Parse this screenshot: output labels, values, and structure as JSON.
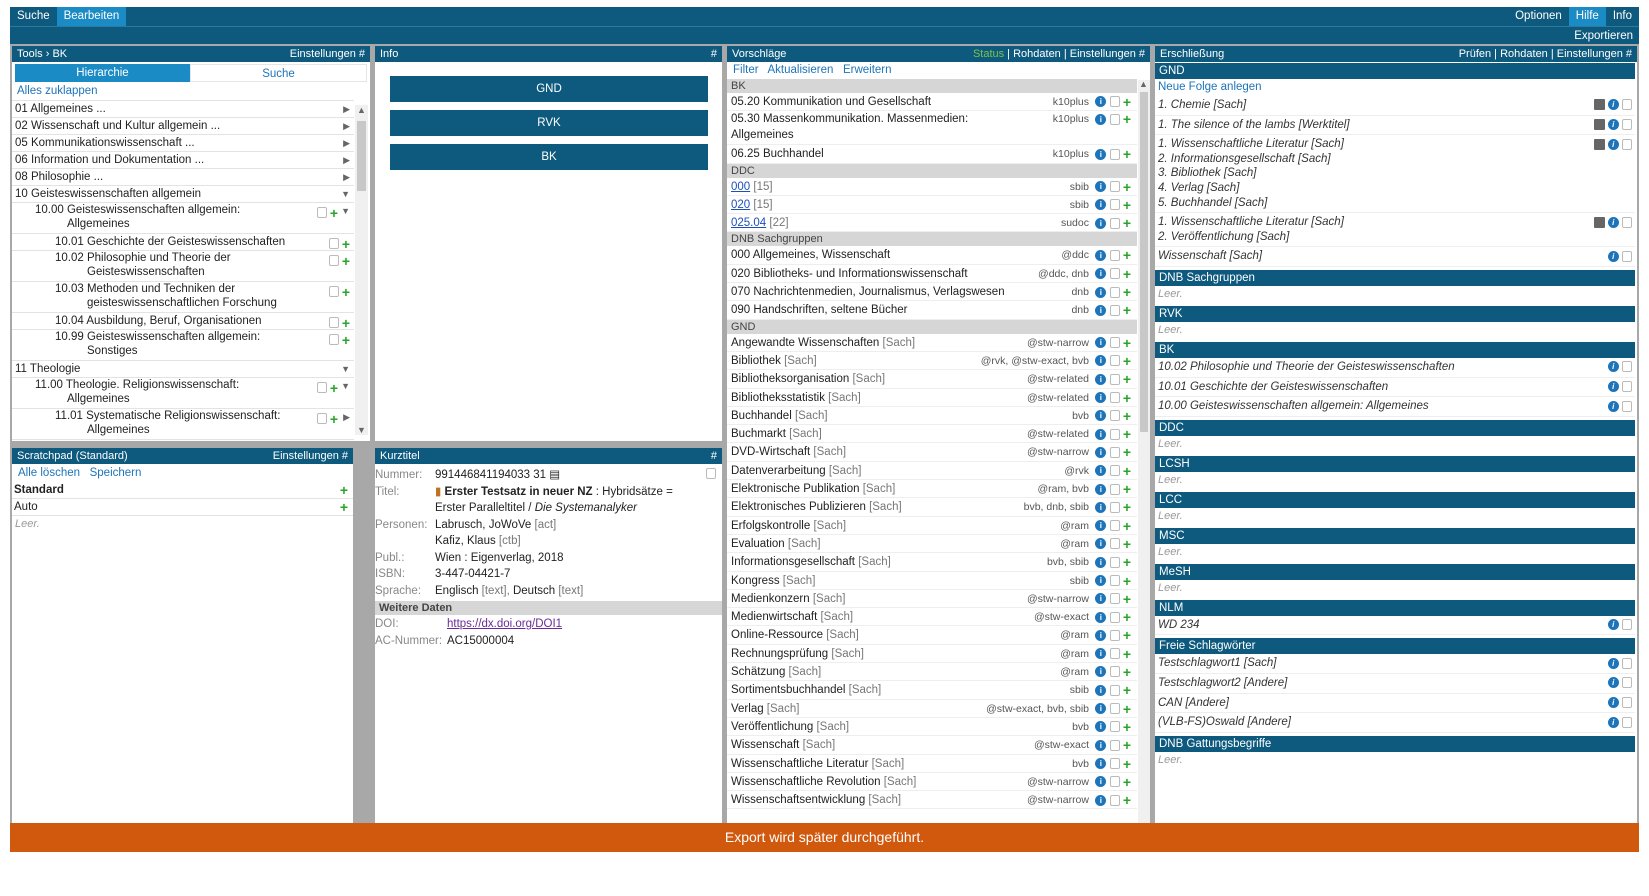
{
  "topbar": {
    "left": [
      "Suche",
      "Bearbeiten"
    ],
    "right": [
      "Optionen",
      "Hilfe",
      "Info"
    ],
    "export": "Exportieren"
  },
  "tools": {
    "title": "Tools › BK",
    "settings": "Einstellungen #",
    "tabs": [
      "Hierarchie",
      "Suche"
    ],
    "collapse_all": "Alles zuklappen",
    "items": [
      {
        "text": "01 Allgemeines ...",
        "indent": 0,
        "arrow": "▶",
        "actions": false
      },
      {
        "text": "02 Wissenschaft und Kultur allgemein ...",
        "indent": 0,
        "arrow": "▶",
        "actions": false
      },
      {
        "text": "05 Kommunikationswissenschaft ...",
        "indent": 0,
        "arrow": "▶",
        "actions": false
      },
      {
        "text": "06 Information und Dokumentation ...",
        "indent": 0,
        "arrow": "▶",
        "actions": false
      },
      {
        "text": "08 Philosophie ...",
        "indent": 0,
        "arrow": "▶",
        "actions": false
      },
      {
        "text": "10 Geisteswissenschaften allgemein",
        "indent": 0,
        "arrow": "▼",
        "actions": false
      },
      {
        "text": "10.00 Geisteswissenschaften allgemein:",
        "text2": "Allgemeines",
        "indent": 1,
        "arrow": "▼",
        "actions": true
      },
      {
        "text": "10.01 Geschichte der Geisteswissenschaften",
        "indent": 2,
        "arrow": "",
        "actions": true
      },
      {
        "text": "10.02 Philosophie und Theorie der",
        "text2": "Geisteswissenschaften",
        "indent": 2,
        "arrow": "",
        "actions": true
      },
      {
        "text": "10.03 Methoden und Techniken der",
        "text2": "geisteswissenschaftlichen Forschung",
        "indent": 2,
        "arrow": "",
        "actions": true
      },
      {
        "text": "10.04 Ausbildung, Beruf, Organisationen",
        "indent": 2,
        "arrow": "",
        "actions": true
      },
      {
        "text": "10.99 Geisteswissenschaften allgemein:",
        "text2": "Sonstiges",
        "indent": 2,
        "arrow": "",
        "actions": true
      },
      {
        "text": "11 Theologie",
        "indent": 0,
        "arrow": "▼",
        "actions": false
      },
      {
        "text": "11.00 Theologie. Religionswissenschaft:",
        "text2": "Allgemeines",
        "indent": 1,
        "arrow": "▼",
        "actions": true
      },
      {
        "text": "11.01 Systematische Religionswissenschaft:",
        "text2": "Allgemeines",
        "indent": 2,
        "arrow": "▶",
        "actions": true
      }
    ]
  },
  "info": {
    "title": "Info",
    "hash": "#",
    "buttons": [
      "GND",
      "RVK",
      "BK"
    ]
  },
  "scratch": {
    "title": "Scratchpad (Standard)",
    "settings": "Einstellungen #",
    "links": [
      "Alle löschen",
      "Speichern"
    ],
    "items": [
      "Standard",
      "Auto"
    ],
    "empty": "Leer."
  },
  "kurz": {
    "title": "Kurztitel",
    "hash": "#",
    "fields": [
      {
        "k": "Nummer:",
        "v": "991446841194033 31 ▤"
      },
      {
        "k": "Titel:",
        "v_bold": "Erster Testsatz in neuer NZ",
        "v": " : Hybridsätze ="
      },
      {
        "k": "",
        "v": "Erster Paralleltitel / ",
        "v_it": "Die Systemanalyker"
      },
      {
        "k": "Personen:",
        "v": "Labrusch, JoWoVe",
        "g": " [act]"
      },
      {
        "k": "",
        "v": "Kafiz, Klaus",
        "g": " [ctb]"
      },
      {
        "k": "Publ.:",
        "v": "Wien : Eigenverlag, 2018"
      },
      {
        "k": "ISBN:",
        "v": "3-447-04421-7"
      },
      {
        "k": "Sprache:",
        "v": "Englisch",
        "g": " [text], ",
        "v3": "Deutsch",
        "g2": " [text]"
      }
    ],
    "more": "Weitere Daten",
    "doi_k": "DOI:",
    "doi_v": "https://dx.doi.org/DOI1",
    "ac_k": "AC-Nummer:",
    "ac_v": "AC15000004"
  },
  "vorschlaege": {
    "title": "Vorschläge",
    "status": "Status",
    "right": " | Rohdaten | Einstellungen #",
    "links": [
      "Filter",
      "Aktualisieren",
      "Erweitern"
    ],
    "sections": [
      {
        "name": "BK",
        "rows": [
          {
            "t": "05.20 Kommunikation und Gesellschaft",
            "s": "k10plus"
          },
          {
            "t": "05.30 Massenkommunikation. Massenmedien:",
            "t2": "Allgemeines",
            "s": "k10plus"
          },
          {
            "t": "06.25 Buchhandel",
            "s": "k10plus"
          }
        ]
      },
      {
        "name": "DDC",
        "rows": [
          {
            "t": "000",
            "g": " [15]",
            "link": true,
            "s": "sbib"
          },
          {
            "t": "020",
            "g": " [15]",
            "link": true,
            "s": "sbib"
          },
          {
            "t": "025.04",
            "g": " [22]",
            "link": true,
            "s": "sudoc"
          }
        ]
      },
      {
        "name": "DNB Sachgruppen",
        "rows": [
          {
            "t": "000 Allgemeines, Wissenschaft",
            "s": "@ddc"
          },
          {
            "t": "020 Bibliotheks- und Informationswissenschaft",
            "s": "@ddc, dnb"
          },
          {
            "t": "070 Nachrichtenmedien, Journalismus, Verlagswesen",
            "s": "dnb"
          },
          {
            "t": "090 Handschriften, seltene Bücher",
            "s": "dnb"
          }
        ]
      },
      {
        "name": "GND",
        "rows": [
          {
            "t": "Angewandte Wissenschaften",
            "g": " [Sach]",
            "s": "@stw-narrow"
          },
          {
            "t": "Bibliothek",
            "g": " [Sach]",
            "s": "@rvk, @stw-exact, bvb"
          },
          {
            "t": "Bibliotheksorganisation",
            "g": " [Sach]",
            "s": "@stw-related"
          },
          {
            "t": "Bibliotheksstatistik",
            "g": " [Sach]",
            "s": "@stw-related"
          },
          {
            "t": "Buchhandel",
            "g": " [Sach]",
            "s": "bvb"
          },
          {
            "t": "Buchmarkt",
            "g": " [Sach]",
            "s": "@stw-related"
          },
          {
            "t": "DVD-Wirtschaft",
            "g": " [Sach]",
            "s": "@stw-narrow"
          },
          {
            "t": "Datenverarbeitung",
            "g": " [Sach]",
            "s": "@rvk"
          },
          {
            "t": "Elektronische Publikation",
            "g": " [Sach]",
            "s": "@ram, bvb"
          },
          {
            "t": "Elektronisches Publizieren",
            "g": " [Sach]",
            "s": "bvb, dnb, sbib"
          },
          {
            "t": "Erfolgskontrolle",
            "g": " [Sach]",
            "s": "@ram"
          },
          {
            "t": "Evaluation",
            "g": " [Sach]",
            "s": "@ram"
          },
          {
            "t": "Informationsgesellschaft",
            "g": " [Sach]",
            "s": "bvb, sbib"
          },
          {
            "t": "Kongress",
            "g": " [Sach]",
            "s": "sbib"
          },
          {
            "t": "Medienkonzern",
            "g": " [Sach]",
            "s": "@stw-narrow"
          },
          {
            "t": "Medienwirtschaft",
            "g": " [Sach]",
            "s": "@stw-exact"
          },
          {
            "t": "Online-Ressource",
            "g": " [Sach]",
            "s": "@ram"
          },
          {
            "t": "Rechnungsprüfung",
            "g": " [Sach]",
            "s": "@ram"
          },
          {
            "t": "Schätzung",
            "g": " [Sach]",
            "s": "@ram"
          },
          {
            "t": "Sortimentsbuchhandel",
            "g": " [Sach]",
            "s": "sbib"
          },
          {
            "t": "Verlag",
            "g": " [Sach]",
            "s": "@stw-exact, bvb, sbib"
          },
          {
            "t": "Veröffentlichung",
            "g": " [Sach]",
            "s": "bvb"
          },
          {
            "t": "Wissenschaft",
            "g": " [Sach]",
            "s": "@stw-exact"
          },
          {
            "t": "Wissenschaftliche Literatur",
            "g": " [Sach]",
            "s": "bvb"
          },
          {
            "t": "Wissenschaftliche Revolution",
            "g": " [Sach]",
            "s": "@stw-narrow"
          },
          {
            "t": "Wissenschaftsentwicklung",
            "g": " [Sach]",
            "s": "@stw-narrow"
          }
        ]
      }
    ]
  },
  "erschliessung": {
    "title": "Erschließung",
    "right": "Prüfen | Rohdaten | Einstellungen #",
    "new_seq": "Neue Folge anlegen",
    "sections": [
      {
        "name": "GND",
        "items": [
          {
            "lines": [
              "1. Chemie [Sach]"
            ],
            "pen": true
          },
          {
            "lines": [
              "1. The silence of the lambs [Werktitel]"
            ],
            "pen": true
          },
          {
            "lines": [
              "1. Wissenschaftliche Literatur [Sach]",
              "2. Informationsgesellschaft [Sach]",
              "3. Bibliothek [Sach]",
              "4. Verlag [Sach]",
              "5. Buchhandel [Sach]"
            ],
            "pen": true
          },
          {
            "lines": [
              "1. Wissenschaftliche Literatur [Sach]",
              "2. Veröffentlichung [Sach]"
            ],
            "pen": true
          },
          {
            "lines": [
              "Wissenschaft [Sach]"
            ],
            "pen": false
          }
        ]
      },
      {
        "name": "DNB Sachgruppen",
        "empty": "Leer."
      },
      {
        "name": "RVK",
        "empty": "Leer."
      },
      {
        "name": "BK",
        "items": [
          {
            "lines": [
              "10.02 Philosophie und Theorie der Geisteswissenschaften"
            ],
            "pen": false
          },
          {
            "lines": [
              "10.01 Geschichte der Geisteswissenschaften"
            ],
            "pen": false
          },
          {
            "lines": [
              "10.00 Geisteswissenschaften allgemein: Allgemeines"
            ],
            "pen": false
          }
        ]
      },
      {
        "name": "DDC",
        "empty": "Leer."
      },
      {
        "name": "LCSH",
        "empty": "Leer."
      },
      {
        "name": "LCC",
        "empty": "Leer."
      },
      {
        "name": "MSC",
        "empty": "Leer."
      },
      {
        "name": "MeSH",
        "empty": "Leer."
      },
      {
        "name": "NLM",
        "items": [
          {
            "lines": [
              "WD 234"
            ],
            "pen": false
          }
        ]
      },
      {
        "name": "Freie Schlagwörter",
        "items": [
          {
            "lines": [
              "Testschlagwort1 [Sach]"
            ],
            "pen": false
          },
          {
            "lines": [
              "Testschlagwort2 [Andere]"
            ],
            "pen": false
          },
          {
            "lines": [
              "CAN [Andere]"
            ],
            "pen": false
          },
          {
            "lines": [
              "(VLB-FS)Oswald [Andere]"
            ],
            "pen": false
          }
        ]
      },
      {
        "name": "DNB Gattungsbegriffe",
        "empty": "Leer."
      }
    ]
  },
  "footer": "Export wird später durchgeführt.",
  "colors": {
    "primary": "#0e5a7e",
    "active": "#1b8bc5",
    "footer": "#d0590d",
    "plus": "#2aa52a"
  }
}
